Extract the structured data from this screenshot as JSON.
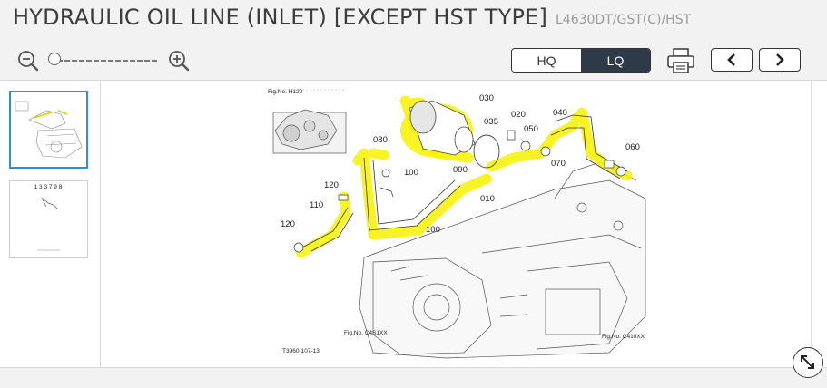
{
  "header": {
    "title": "HYDRAULIC OIL LINE (INLET) [EXCEPT HST TYPE]",
    "model": "L4630DT/GST(C)/HST"
  },
  "toolbar": {
    "zoom_out_icon": "zoom-out-icon",
    "zoom_in_icon": "zoom-in-icon",
    "quality_options": [
      "HQ",
      "LQ"
    ],
    "quality_selected": "LQ",
    "print_icon": "printer-icon",
    "prev_icon": "chevron-left-icon",
    "next_icon": "chevron-right-icon"
  },
  "diagram": {
    "fig_h120": "Fig.No. H120",
    "fig_c4": "Fig.No. C4S1XX",
    "fig_c410": "Fig.No. C410XX",
    "drawing_code": "T3960-107-13",
    "callouts": [
      "030",
      "035",
      "020",
      "050",
      "040",
      "080",
      "100",
      "060",
      "070",
      "090",
      "010",
      "120",
      "110",
      "120",
      "100"
    ],
    "highlight_color": "#f7f200"
  },
  "thumbnail2_text": "1 3 3 7 9 8"
}
